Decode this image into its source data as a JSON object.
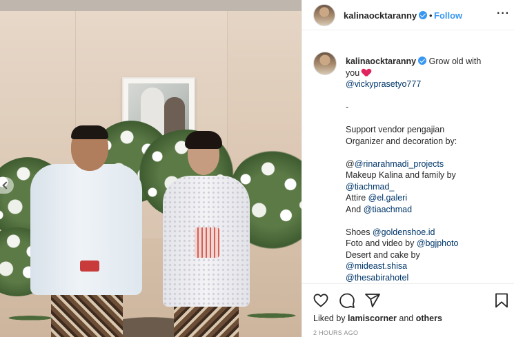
{
  "post": {
    "username": "kalinaocktaranny",
    "verified": true,
    "separator": "•",
    "follow_label": "Follow",
    "more_label": "···"
  },
  "caption": {
    "username": "kalinaocktaranny",
    "lines": [
      {
        "text": " Grow old with"
      },
      {
        "text": "you "
      },
      {
        "mention": "@vickyprasetyo777"
      },
      {
        "text": ""
      },
      {
        "text": "-"
      },
      {
        "text": ""
      },
      {
        "text": "Support vendor pengajian"
      },
      {
        "text": "Organizer and decoration by:"
      },
      {
        "text": ""
      },
      {
        "prefix": "@",
        "mention": "@rinarahmadi_projects"
      },
      {
        "text": "Makeup Kalina and family by"
      },
      {
        "mention": "@tiachmad_"
      },
      {
        "prefix": "Attire ",
        "mention": "@el.galeri"
      },
      {
        "prefix": "And ",
        "mention": "@tiaachmad"
      },
      {
        "text": ""
      },
      {
        "prefix": "Shoes ",
        "mention": "@goldenshoe.id"
      },
      {
        "prefix": "Foto and video by ",
        "mention": "@bgjphoto"
      },
      {
        "text": "Desert and cake by"
      },
      {
        "mention": "@mideast.shisa"
      },
      {
        "mention": "@thesabirahotel"
      }
    ]
  },
  "footer": {
    "like_prefix": "Liked by ",
    "liked_by_user": "lamiscorner",
    "like_middle": " and ",
    "others": "others",
    "timestamp": "2 HOURS AGO"
  },
  "icons": {
    "like": "heart-outline-icon",
    "comment": "comment-bubble-icon",
    "share": "paper-plane-icon",
    "save": "bookmark-icon",
    "verified": "verified-badge-icon",
    "carousel_prev": "chevron-left-icon"
  },
  "colors": {
    "link_blue": "#3897f0",
    "mention": "#00376b",
    "heart": "#e0245e",
    "muted": "#8e8e8e"
  }
}
